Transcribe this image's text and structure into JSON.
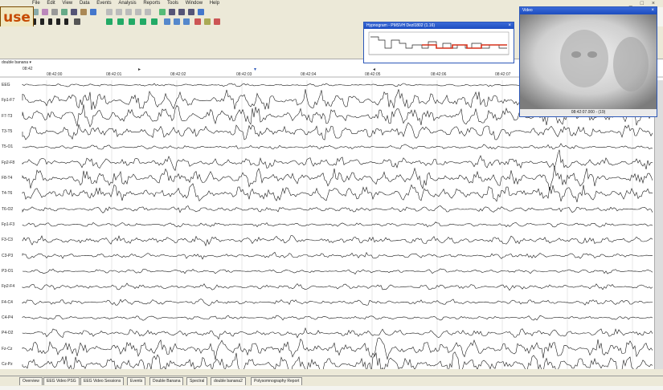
{
  "menu": [
    "File",
    "Edit",
    "View",
    "Data",
    "Events",
    "Analysis",
    "Reports",
    "Tools",
    "Window",
    "Help"
  ],
  "pause_label": "use ]",
  "montage": {
    "name": "double banana"
  },
  "timeline": {
    "marker_ticks": [
      "08:42:00",
      "08:42:01",
      "08:42:02",
      "08:42:03",
      "08:42:04",
      "08:42:05",
      "08:42:06",
      "08:42:07",
      "08:42:08"
    ],
    "start_label": "08:42"
  },
  "channels": [
    "EEG",
    "Fp1-F7",
    "F7-T3",
    "T3-T5",
    "T5-O1",
    "Fp2-F8",
    "F8-T4",
    "T4-T6",
    "T6-O2",
    "Fp1-F3",
    "F3-C3",
    "C3-P3",
    "P3-O1",
    "Fp2-F4",
    "F4-C4",
    "C4-P4",
    "P4-O2",
    "Fz-Cz",
    "Cz-Pz"
  ],
  "hypnogram": {
    "title": "Hypnogram - PMSVH Dezl1802 (1.16)"
  },
  "video": {
    "title": "Video",
    "timestamp": "08:42:07.000 - (19)"
  },
  "tabs": [
    "Overview",
    "EEG Video PSG",
    "EEG Video Sessions",
    "Events",
    "Double Banana",
    "Spectral",
    "double banana2",
    "Polysomnography Report"
  ],
  "status": {
    "left": "",
    "right": ""
  },
  "colors": {
    "title_blue": "#2c57b8",
    "pause_orange": "#c64a00",
    "hypno_red": "#d6301a"
  }
}
